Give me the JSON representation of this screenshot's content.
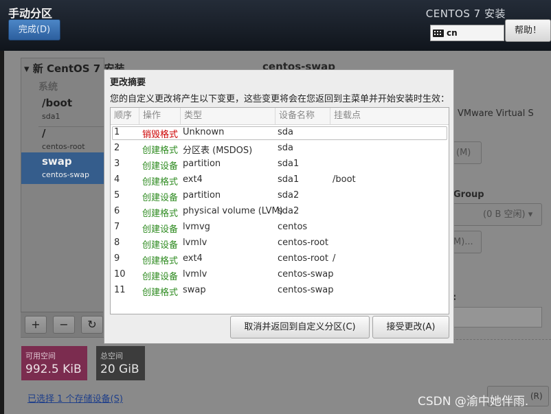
{
  "header": {
    "title": "手动分区",
    "done_label": "完成(D)",
    "product_title": "CENTOS 7 安装",
    "keyboard_layout": "cn",
    "help_label": "帮助！"
  },
  "left_panel": {
    "install_title": "新 CentOS 7 安装",
    "category": "系统",
    "partitions": [
      {
        "name": "/boot",
        "device": "sda1"
      },
      {
        "name": "/",
        "device": "centos-root"
      },
      {
        "name": "swap",
        "device": "centos-swap"
      }
    ],
    "toolbar": {
      "add": "+",
      "remove": "−",
      "refresh": "↻"
    },
    "available_space": {
      "label": "可用空间",
      "value": "992.5 KiB"
    },
    "total_space": {
      "label": "总空间",
      "value": "20 GiB"
    },
    "storage_link": "已选择 1 个存储设备(S)"
  },
  "right_panel": {
    "title": "centos-swap",
    "device_text": "VMware Virtual S",
    "modify_button": "(M)",
    "group_label": "Group",
    "group_select": "(0 B 空闲)",
    "modify_group_button": "M)...",
    "bottom_button": "(R)"
  },
  "dialog": {
    "title": "更改摘要",
    "description": "您的自定义更改将产生以下变更，这些变更将会在您返回到主菜单并开始安装时生效：",
    "columns": [
      "顺序",
      "操作",
      "类型",
      "设备名称",
      "挂载点"
    ],
    "rows": [
      {
        "order": "1",
        "action": "销毁格式",
        "kind": "destroy",
        "type": "Unknown",
        "device": "sda",
        "mount": ""
      },
      {
        "order": "2",
        "action": "创建格式",
        "kind": "create",
        "type": "分区表 (MSDOS)",
        "device": "sda",
        "mount": ""
      },
      {
        "order": "3",
        "action": "创建设备",
        "kind": "create",
        "type": "partition",
        "device": "sda1",
        "mount": ""
      },
      {
        "order": "4",
        "action": "创建格式",
        "kind": "create",
        "type": "ext4",
        "device": "sda1",
        "mount": "/boot"
      },
      {
        "order": "5",
        "action": "创建设备",
        "kind": "create",
        "type": "partition",
        "device": "sda2",
        "mount": ""
      },
      {
        "order": "6",
        "action": "创建格式",
        "kind": "create",
        "type": "physical volume (LVM)",
        "device": "sda2",
        "mount": ""
      },
      {
        "order": "7",
        "action": "创建设备",
        "kind": "create",
        "type": "lvmvg",
        "device": "centos",
        "mount": ""
      },
      {
        "order": "8",
        "action": "创建设备",
        "kind": "create",
        "type": "lvmlv",
        "device": "centos-root",
        "mount": ""
      },
      {
        "order": "9",
        "action": "创建格式",
        "kind": "create",
        "type": "ext4",
        "device": "centos-root",
        "mount": "/"
      },
      {
        "order": "10",
        "action": "创建设备",
        "kind": "create",
        "type": "lvmlv",
        "device": "centos-swap",
        "mount": ""
      },
      {
        "order": "11",
        "action": "创建格式",
        "kind": "create",
        "type": "swap",
        "device": "centos-swap",
        "mount": ""
      }
    ],
    "cancel_label": "取消并返回到自定义分区(C)",
    "accept_label": "接受更改(A)"
  },
  "watermark": "CSDN @渝中她伴雨."
}
